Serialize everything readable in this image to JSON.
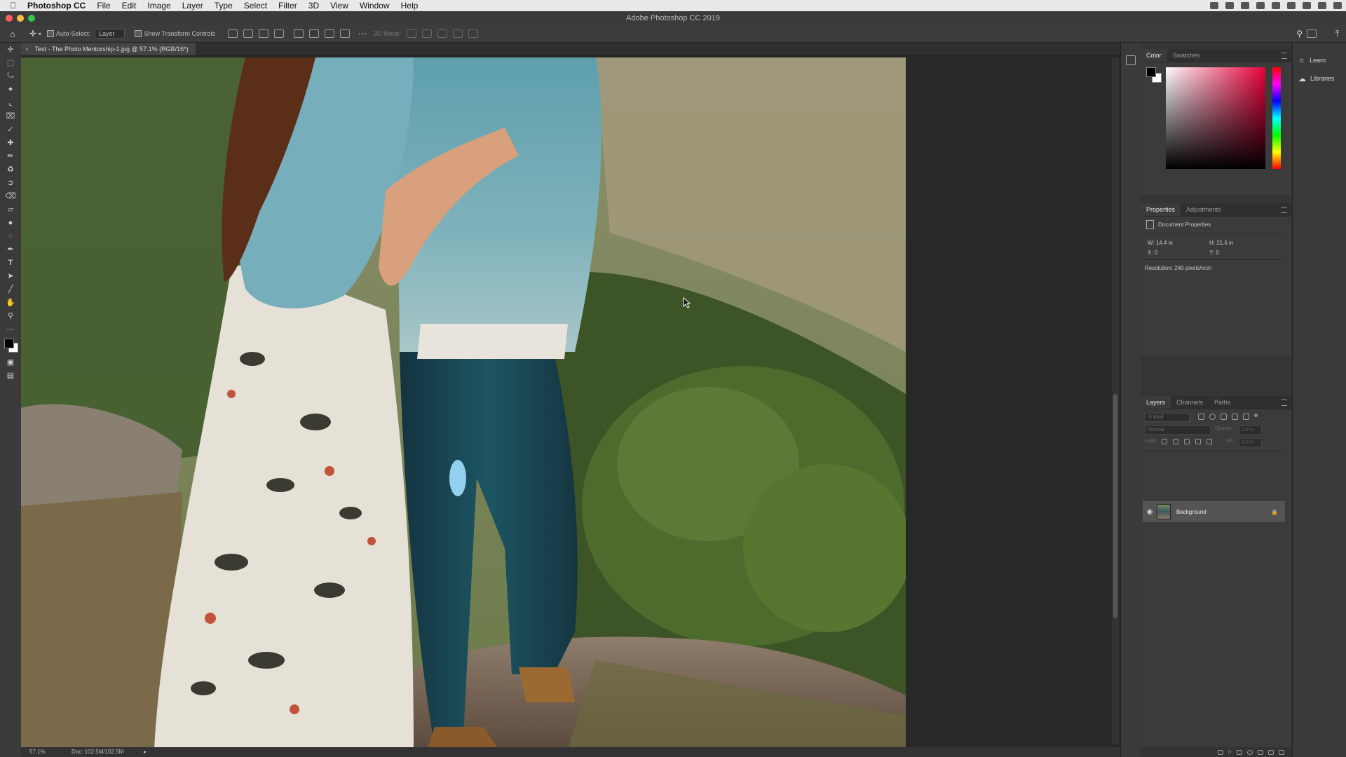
{
  "menubar": {
    "apple": "",
    "items": [
      "Photoshop CC",
      "File",
      "Edit",
      "Image",
      "Layer",
      "Type",
      "Select",
      "Filter",
      "3D",
      "View",
      "Window",
      "Help"
    ]
  },
  "titlebar": {
    "title": "Adobe Photoshop CC 2019"
  },
  "options": {
    "auto_select_label": "Auto-Select:",
    "auto_select_value": "Layer",
    "transform_label": "Show Transform Controls",
    "mode_3d": "3D Mode:"
  },
  "document": {
    "tab_title": "Test - The Photo Mentorship-1.jpg @ 57.1% (RGB/16*)"
  },
  "status": {
    "zoom": "57.1%",
    "doc": "Doc: 102.5M/102.5M"
  },
  "panels": {
    "color": {
      "tabs": [
        "Color",
        "Swatches"
      ],
      "active": "Color"
    },
    "properties": {
      "tabs": [
        "Properties",
        "Adjustments"
      ],
      "header": "Document Properties",
      "w": "W: 14.4 in",
      "h": "H: 21.6 in",
      "x": "X: 0",
      "y": "Y: 0",
      "resolution": "Resolution: 240 pixels/inch"
    },
    "layers": {
      "tabs": [
        "Layers",
        "Channels",
        "Paths"
      ],
      "kind_placeholder": "Kind",
      "blend_mode": "Normal",
      "opacity_label": "Opacity:",
      "opacity_value": "100%",
      "lock_label": "Lock:",
      "fill_label": "Fill:",
      "fill_value": "100%",
      "layer_name": "Background"
    }
  },
  "rightcol": {
    "learn": "Learn",
    "libraries": "Libraries"
  },
  "colors": {
    "accent_red": "#e8003a",
    "fg_swatch": "#000000",
    "bg_swatch": "#ffffff"
  }
}
